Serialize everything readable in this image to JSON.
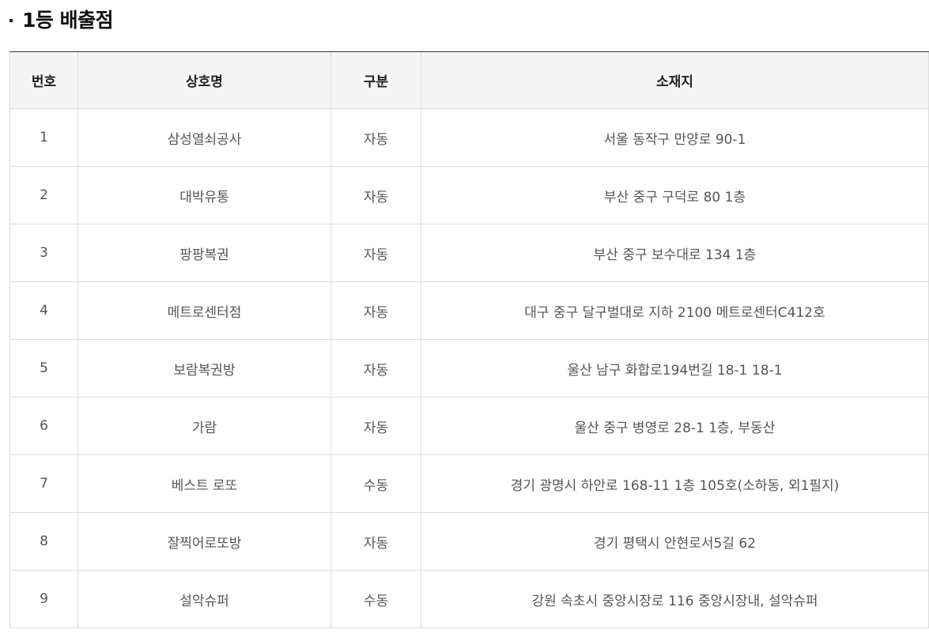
{
  "section": {
    "title": "1등 배출점"
  },
  "table": {
    "headers": {
      "no": "번호",
      "name": "상호명",
      "type": "구분",
      "address": "소재지"
    },
    "rows": [
      {
        "no": "1",
        "name": "삼성열쇠공사",
        "type": "자동",
        "address": "서울 동작구 만양로 90-1"
      },
      {
        "no": "2",
        "name": "대박유통",
        "type": "자동",
        "address": "부산 중구 구덕로 80 1층"
      },
      {
        "no": "3",
        "name": "팡팡복권",
        "type": "자동",
        "address": "부산 중구 보수대로 134 1층"
      },
      {
        "no": "4",
        "name": "메트로센터점",
        "type": "자동",
        "address": "대구 중구 달구벌대로 지하 2100 메트로센터C412호"
      },
      {
        "no": "5",
        "name": "보람복권방",
        "type": "자동",
        "address": "울산 남구 화합로194번길 18-1 18-1"
      },
      {
        "no": "6",
        "name": "가람",
        "type": "자동",
        "address": "울산 중구 병영로 28-1 1층, 부동산"
      },
      {
        "no": "7",
        "name": "베스트 로또",
        "type": "수동",
        "address": "경기 광명시 하안로 168-11 1층 105호(소하동, 외1필지)"
      },
      {
        "no": "8",
        "name": "잘찍어로또방",
        "type": "자동",
        "address": "경기 평택시 안현로서5길 62"
      },
      {
        "no": "9",
        "name": "설악슈퍼",
        "type": "수동",
        "address": "강원 속초시 중앙시장로 116 중앙시장내, 설악슈퍼"
      }
    ]
  }
}
